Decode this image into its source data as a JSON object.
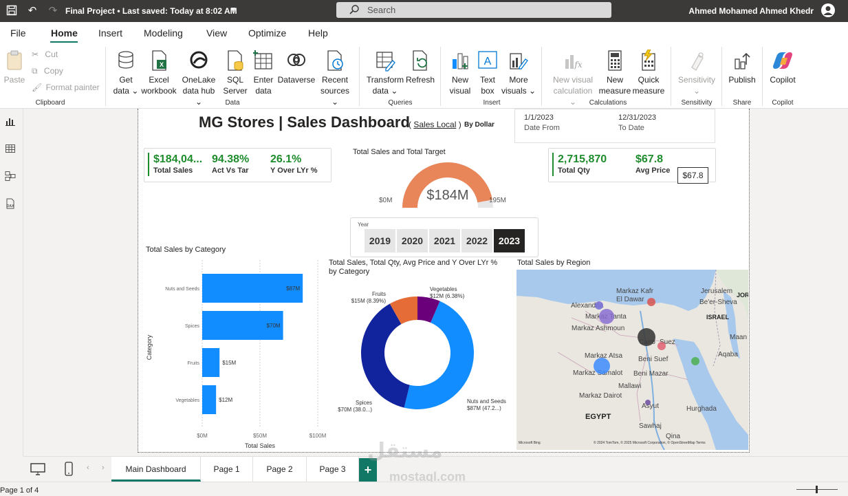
{
  "titlebar": {
    "file_title": "Final Project • Last saved: Today at 8:02 AM",
    "search_placeholder": "Search",
    "user_name": "Ahmed Mohamed Ahmed Khedr"
  },
  "menu": {
    "items": [
      "File",
      "Home",
      "Insert",
      "Modeling",
      "View",
      "Optimize",
      "Help"
    ],
    "active": "Home"
  },
  "ribbon": {
    "clipboard": {
      "paste": "Paste",
      "cut": "Cut",
      "copy": "Copy",
      "format_painter": "Format painter",
      "group": "Clipboard"
    },
    "data": {
      "get_data": [
        "Get",
        "data ⌄"
      ],
      "excel": [
        "Excel",
        "workbook"
      ],
      "onelake": [
        "OneLake",
        "data hub ⌄"
      ],
      "sql": [
        "SQL",
        "Server"
      ],
      "enter": [
        "Enter",
        "data"
      ],
      "dataverse": [
        "Dataverse",
        ""
      ],
      "recent": [
        "Recent",
        "sources ⌄"
      ],
      "group": "Data"
    },
    "queries": {
      "transform": [
        "Transform",
        "data ⌄"
      ],
      "refresh": [
        "Refresh",
        ""
      ],
      "group": "Queries"
    },
    "insert": {
      "new_visual": [
        "New",
        "visual"
      ],
      "text_box": [
        "Text",
        "box"
      ],
      "more_visuals": [
        "More",
        "visuals ⌄"
      ],
      "group": "Insert"
    },
    "calculations": {
      "new_visual_calc": [
        "New visual",
        "calculation ⌄"
      ],
      "new_measure": [
        "New",
        "measure"
      ],
      "quick_measure": [
        "Quick",
        "measure"
      ],
      "group": "Calculations"
    },
    "sensitivity": {
      "label": [
        "Sensitivity",
        "⌄"
      ],
      "group": "Sensitivity"
    },
    "share": {
      "publish": [
        "Publish",
        ""
      ],
      "group": "Share"
    },
    "copilot": {
      "label": [
        "Copilot",
        ""
      ],
      "group": "Copilot"
    }
  },
  "dashboard": {
    "title": "MG Stores | Sales Dashboard",
    "sub_open": "( ",
    "sub_link": "Sales Local",
    "sub_close": " )",
    "by": "By Dollar",
    "date_from_value": "1/1/2023",
    "date_from_label": "Date From",
    "date_to_value": "12/31/2023",
    "date_to_label": "To Date",
    "kpi_left": [
      {
        "value": "$184,04...",
        "label": "Total Sales"
      },
      {
        "value": "94.38%",
        "label": "Act Vs Tar"
      },
      {
        "value": "26.1%",
        "label": "Y Over LYr %"
      }
    ],
    "kpi_right": [
      {
        "value": "2,715,870",
        "label": "Total Qty"
      },
      {
        "value": "$67.8",
        "label": "Avg Price"
      }
    ],
    "price_box": "$67.8",
    "gauge_title": "Total Sales and Total Target",
    "gauge_value": "$184M",
    "gauge_min": "$0M",
    "gauge_max": "195M",
    "slicer_label": "Year",
    "years": [
      "2019",
      "2020",
      "2021",
      "2022",
      "2023"
    ],
    "selected_year": "2023",
    "bar_title": "Total Sales by Category",
    "donut_title_1": "Total Sales, Total Qty, Avg Price and Y Over LYr %",
    "donut_title_2": "by Category",
    "map_title": "Total Sales by Region"
  },
  "chart_data": [
    {
      "type": "bar",
      "title": "Total Sales by Category",
      "orientation": "horizontal",
      "categories": [
        "Nuts and Seeds",
        "Spices",
        "Fruits",
        "Vegetables"
      ],
      "values": [
        87,
        70,
        15,
        12
      ],
      "data_labels": [
        "$87M",
        "$70M",
        "$15M",
        "$12M"
      ],
      "xlabel": "Total Sales",
      "ylabel": "Category",
      "xticks": [
        "$0M",
        "$50M",
        "$100M"
      ],
      "xlim": [
        0,
        100
      ],
      "color": "#118dff"
    },
    {
      "type": "pie",
      "title": "Total Sales, Total Qty, Avg Price and Y Over LYr % by Category",
      "donut": true,
      "slices": [
        {
          "name": "Nuts and Seeds",
          "value": 87,
          "label": "$87M (47.2...)",
          "color": "#118dff"
        },
        {
          "name": "Spices",
          "value": 70,
          "label": "$70M (38.0...)",
          "color": "#12239e"
        },
        {
          "name": "Fruits",
          "value": 15,
          "label": "$15M (8.39%)",
          "color": "#e66c37"
        },
        {
          "name": "Vegetables",
          "value": 12,
          "label": "$12M (6.38%)",
          "color": "#6b007b"
        }
      ]
    },
    {
      "type": "gauge",
      "title": "Total Sales and Total Target",
      "value": 184,
      "min": 0,
      "max": 195,
      "color": "#e8865a"
    }
  ],
  "map": {
    "labels": [
      "Alexandria",
      "Markaz Kafr",
      "El Dawar",
      "Markaz Tanta",
      "Markaz Ashmoun",
      "Cairo",
      "Suez",
      "Beni Suef",
      "Markaz Atsa",
      "Markaz Samalot",
      "Beni Mazar",
      "Mallawi",
      "Markaz Dairot",
      "Asyut",
      "EGYPT",
      "Sawhaj",
      "Qina",
      "Hurghada",
      "Jerusalem",
      "Be'er-Sheva",
      "ISRAEL",
      "Aqaba",
      "Maan",
      "JOR"
    ],
    "attribution_left": "Microsoft Bing",
    "attribution_right": "© 2024 TomTom, © 2025 Microsoft Corporation, © OpenStreetMap Terms"
  },
  "pages": {
    "tabs": [
      "Main Dashboard",
      "Page 1",
      "Page 2",
      "Page 3"
    ],
    "active": "Main Dashboard",
    "add": "+",
    "status": "Page 1 of 4"
  },
  "watermark": {
    "text1": "مستقل",
    "text2": "mostaql.com"
  },
  "colors": {
    "accent": "#117865",
    "kpi_green": "#1e8c2c",
    "bar": "#118dff"
  }
}
